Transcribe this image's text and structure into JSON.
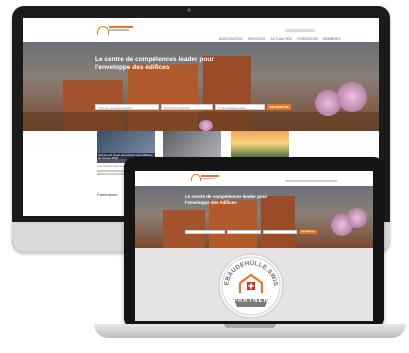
{
  "desktop_site": {
    "nav": {
      "items": [
        "ASSOCIATION",
        "SERVICES",
        "ACTUALITÉS",
        "FORMATION",
        "MEMBRES"
      ],
      "search_label": "Q"
    },
    "hero": {
      "headline": "Le centre de compétences leader pour l'enveloppe des édifices",
      "search": {
        "field1_placeholder": "Type de produit/prestation",
        "field2_placeholder": "Nom de l'entreprise",
        "field3_placeholder": "Code postal/Localité",
        "button_label": "RECHERCHE"
      }
    },
    "cards": [
      {
        "title": "Adresse du projet «Enveloppe des édifices» de l'année 2018",
        "text": "Lorem ipsum dolor sit amet"
      },
      {
        "title": "",
        "text": ""
      },
      {
        "title": "",
        "text": ""
      }
    ],
    "footer_link": "Partenaires"
  },
  "laptop_site": {
    "hero": {
      "headline": "Le centre de compétences leader pour l'enveloppe des édifices",
      "button_label": "RECHERCHE"
    },
    "badge": {
      "top_text": "GEBÄUDEHÜLLE.SWISS",
      "bottom_text": "PARTNER"
    }
  },
  "colors": {
    "accent": "#e87722",
    "swiss_red": "#d52b1e",
    "seal_grey": "#6f6f6f"
  }
}
